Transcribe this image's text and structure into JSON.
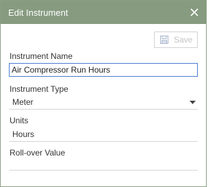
{
  "dialog": {
    "title": "Edit Instrument",
    "close_icon": "close-icon"
  },
  "toolbar": {
    "save_label": "Save",
    "save_icon": "save-icon",
    "save_enabled": false
  },
  "form": {
    "instrument_name": {
      "label": "Instrument Name",
      "value": "Air Compressor Run Hours"
    },
    "instrument_type": {
      "label": "Instrument Type",
      "value": "Meter"
    },
    "units": {
      "label": "Units",
      "value": "Hours"
    },
    "rollover_value": {
      "label": "Roll-over Value",
      "value": ""
    }
  },
  "colors": {
    "titlebar": "#869b80",
    "focus_border": "#4a7bd1",
    "disabled_text": "#c3c3c3"
  }
}
